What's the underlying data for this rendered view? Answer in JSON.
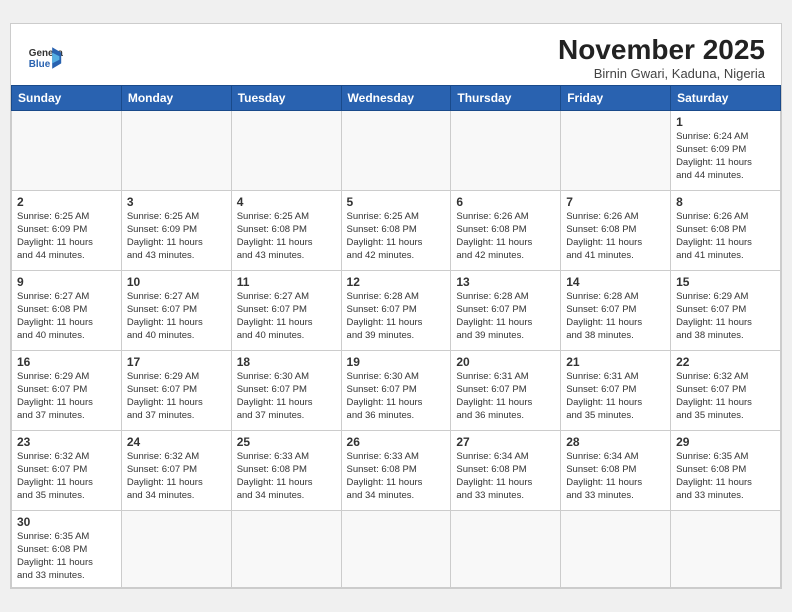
{
  "header": {
    "logo_general": "General",
    "logo_blue": "Blue",
    "month_title": "November 2025",
    "location": "Birnin Gwari, Kaduna, Nigeria"
  },
  "weekdays": [
    "Sunday",
    "Monday",
    "Tuesday",
    "Wednesday",
    "Thursday",
    "Friday",
    "Saturday"
  ],
  "days": [
    {
      "day": "",
      "info": ""
    },
    {
      "day": "",
      "info": ""
    },
    {
      "day": "",
      "info": ""
    },
    {
      "day": "",
      "info": ""
    },
    {
      "day": "",
      "info": ""
    },
    {
      "day": "",
      "info": ""
    },
    {
      "day": "1",
      "info": "Sunrise: 6:24 AM\nSunset: 6:09 PM\nDaylight: 11 hours\nand 44 minutes."
    },
    {
      "day": "2",
      "info": "Sunrise: 6:25 AM\nSunset: 6:09 PM\nDaylight: 11 hours\nand 44 minutes."
    },
    {
      "day": "3",
      "info": "Sunrise: 6:25 AM\nSunset: 6:09 PM\nDaylight: 11 hours\nand 43 minutes."
    },
    {
      "day": "4",
      "info": "Sunrise: 6:25 AM\nSunset: 6:08 PM\nDaylight: 11 hours\nand 43 minutes."
    },
    {
      "day": "5",
      "info": "Sunrise: 6:25 AM\nSunset: 6:08 PM\nDaylight: 11 hours\nand 42 minutes."
    },
    {
      "day": "6",
      "info": "Sunrise: 6:26 AM\nSunset: 6:08 PM\nDaylight: 11 hours\nand 42 minutes."
    },
    {
      "day": "7",
      "info": "Sunrise: 6:26 AM\nSunset: 6:08 PM\nDaylight: 11 hours\nand 41 minutes."
    },
    {
      "day": "8",
      "info": "Sunrise: 6:26 AM\nSunset: 6:08 PM\nDaylight: 11 hours\nand 41 minutes."
    },
    {
      "day": "9",
      "info": "Sunrise: 6:27 AM\nSunset: 6:08 PM\nDaylight: 11 hours\nand 40 minutes."
    },
    {
      "day": "10",
      "info": "Sunrise: 6:27 AM\nSunset: 6:07 PM\nDaylight: 11 hours\nand 40 minutes."
    },
    {
      "day": "11",
      "info": "Sunrise: 6:27 AM\nSunset: 6:07 PM\nDaylight: 11 hours\nand 40 minutes."
    },
    {
      "day": "12",
      "info": "Sunrise: 6:28 AM\nSunset: 6:07 PM\nDaylight: 11 hours\nand 39 minutes."
    },
    {
      "day": "13",
      "info": "Sunrise: 6:28 AM\nSunset: 6:07 PM\nDaylight: 11 hours\nand 39 minutes."
    },
    {
      "day": "14",
      "info": "Sunrise: 6:28 AM\nSunset: 6:07 PM\nDaylight: 11 hours\nand 38 minutes."
    },
    {
      "day": "15",
      "info": "Sunrise: 6:29 AM\nSunset: 6:07 PM\nDaylight: 11 hours\nand 38 minutes."
    },
    {
      "day": "16",
      "info": "Sunrise: 6:29 AM\nSunset: 6:07 PM\nDaylight: 11 hours\nand 37 minutes."
    },
    {
      "day": "17",
      "info": "Sunrise: 6:29 AM\nSunset: 6:07 PM\nDaylight: 11 hours\nand 37 minutes."
    },
    {
      "day": "18",
      "info": "Sunrise: 6:30 AM\nSunset: 6:07 PM\nDaylight: 11 hours\nand 37 minutes."
    },
    {
      "day": "19",
      "info": "Sunrise: 6:30 AM\nSunset: 6:07 PM\nDaylight: 11 hours\nand 36 minutes."
    },
    {
      "day": "20",
      "info": "Sunrise: 6:31 AM\nSunset: 6:07 PM\nDaylight: 11 hours\nand 36 minutes."
    },
    {
      "day": "21",
      "info": "Sunrise: 6:31 AM\nSunset: 6:07 PM\nDaylight: 11 hours\nand 35 minutes."
    },
    {
      "day": "22",
      "info": "Sunrise: 6:32 AM\nSunset: 6:07 PM\nDaylight: 11 hours\nand 35 minutes."
    },
    {
      "day": "23",
      "info": "Sunrise: 6:32 AM\nSunset: 6:07 PM\nDaylight: 11 hours\nand 35 minutes."
    },
    {
      "day": "24",
      "info": "Sunrise: 6:32 AM\nSunset: 6:07 PM\nDaylight: 11 hours\nand 34 minutes."
    },
    {
      "day": "25",
      "info": "Sunrise: 6:33 AM\nSunset: 6:08 PM\nDaylight: 11 hours\nand 34 minutes."
    },
    {
      "day": "26",
      "info": "Sunrise: 6:33 AM\nSunset: 6:08 PM\nDaylight: 11 hours\nand 34 minutes."
    },
    {
      "day": "27",
      "info": "Sunrise: 6:34 AM\nSunset: 6:08 PM\nDaylight: 11 hours\nand 33 minutes."
    },
    {
      "day": "28",
      "info": "Sunrise: 6:34 AM\nSunset: 6:08 PM\nDaylight: 11 hours\nand 33 minutes."
    },
    {
      "day": "29",
      "info": "Sunrise: 6:35 AM\nSunset: 6:08 PM\nDaylight: 11 hours\nand 33 minutes."
    },
    {
      "day": "30",
      "info": "Sunrise: 6:35 AM\nSunset: 6:08 PM\nDaylight: 11 hours\nand 33 minutes."
    },
    {
      "day": "",
      "info": ""
    },
    {
      "day": "",
      "info": ""
    },
    {
      "day": "",
      "info": ""
    },
    {
      "day": "",
      "info": ""
    },
    {
      "day": "",
      "info": ""
    },
    {
      "day": "",
      "info": ""
    }
  ]
}
